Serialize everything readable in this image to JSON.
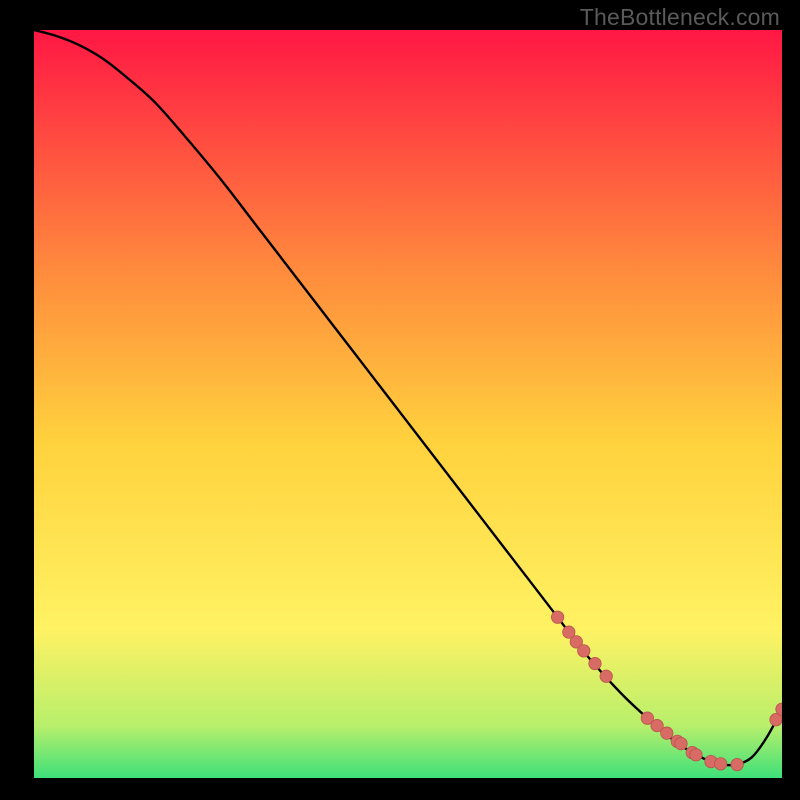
{
  "watermark": "TheBottleneck.com",
  "colors": {
    "background_black": "#000000",
    "curve": "#000000",
    "marker_fill": "#d86b63",
    "marker_stroke": "#b8544c",
    "watermark_text": "#5a5a5a",
    "gradient_top": "#ff1744",
    "gradient_mid_upper": "#ff8a3d",
    "gradient_mid": "#ffd23d",
    "gradient_mid_lower": "#fff263",
    "gradient_green_upper": "#b8ef6b",
    "gradient_green_lower": "#3ee07a"
  },
  "chart_data": {
    "type": "line",
    "title": "",
    "xlabel": "",
    "ylabel": "",
    "xlim": [
      0,
      100
    ],
    "ylim": [
      0,
      100
    ],
    "grid": false,
    "series": [
      {
        "name": "curve",
        "x": [
          0,
          3,
          6,
          9,
          12,
          16,
          20,
          25,
          30,
          35,
          40,
          45,
          50,
          55,
          60,
          65,
          70,
          73,
          76,
          79,
          82,
          84,
          86,
          88,
          90,
          92,
          94,
          96,
          98,
          100
        ],
        "y": [
          100,
          99.2,
          98,
          96.3,
          94,
          90.5,
          86,
          80,
          73.5,
          67,
          60.5,
          54,
          47.5,
          41,
          34.5,
          28,
          21.5,
          17.5,
          14,
          10.8,
          8,
          6.2,
          4.7,
          3.4,
          2.4,
          1.8,
          1.8,
          2.8,
          5.5,
          9.2
        ]
      }
    ],
    "markers": {
      "name": "highlight-points",
      "x": [
        70,
        71.5,
        72.5,
        73.5,
        75,
        76.5,
        82,
        83.3,
        84.6,
        86,
        86.5,
        88,
        88.5,
        90.5,
        91.8,
        94,
        99.2,
        100
      ],
      "y": [
        21.5,
        19.5,
        18.2,
        17,
        15.3,
        13.6,
        8,
        7,
        6,
        4.9,
        4.6,
        3.4,
        3.1,
        2.2,
        1.9,
        1.8,
        7.8,
        9.2
      ]
    }
  }
}
